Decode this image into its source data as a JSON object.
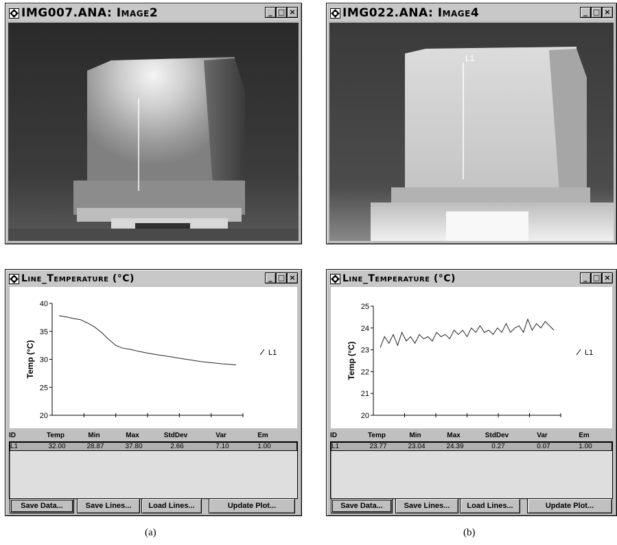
{
  "panels": {
    "a": {
      "image_window_title": "IMG007.ANA: Image2",
      "image_line_label": "",
      "plot_window_title": "Line_Temperature (°C)",
      "caption": "(a)",
      "chart_data": {
        "type": "line",
        "ylabel": "Temp (°C)",
        "ylim": [
          20,
          40
        ],
        "yticks": [
          "20",
          "25",
          "30",
          "35",
          "40"
        ],
        "legend": "L1",
        "series": [
          {
            "name": "L1",
            "x": [
              0,
              0.04,
              0.08,
              0.12,
              0.16,
              0.2,
              0.24,
              0.28,
              0.32,
              0.36,
              0.4,
              0.44,
              0.5,
              0.56,
              0.62,
              0.68,
              0.74,
              0.8,
              0.86,
              0.92,
              0.96,
              1.0
            ],
            "values": [
              37.8,
              37.6,
              37.3,
              37.1,
              36.5,
              35.8,
              34.8,
              33.6,
              32.5,
              32.0,
              31.8,
              31.5,
              31.1,
              30.8,
              30.5,
              30.2,
              29.9,
              29.6,
              29.4,
              29.2,
              29.1,
              29.0
            ]
          }
        ]
      },
      "stats": {
        "headers": [
          "ID",
          "Temp",
          "Min",
          "Max",
          "StdDev",
          "Var",
          "Em"
        ],
        "row": [
          "L1",
          "32.00",
          "28.87",
          "37.80",
          "2.66",
          "7.10",
          "1.00"
        ]
      },
      "buttons": [
        "Save Data...",
        "Save Lines...",
        "Load Lines...",
        "Update Plot..."
      ]
    },
    "b": {
      "image_window_title": "IMG022.ANA: Image4",
      "image_line_label": "L1",
      "plot_window_title": "Line_Temperature (°C)",
      "caption": "(b)",
      "chart_data": {
        "type": "line",
        "ylabel": "Temp (°C)",
        "ylim": [
          20,
          25
        ],
        "yticks": [
          "20",
          "21",
          "22",
          "23",
          "24",
          "25"
        ],
        "legend": "L1",
        "series": [
          {
            "name": "L1",
            "x": [
              0,
              0.025,
              0.05,
              0.075,
              0.1,
              0.125,
              0.15,
              0.175,
              0.2,
              0.225,
              0.25,
              0.275,
              0.3,
              0.325,
              0.35,
              0.375,
              0.4,
              0.425,
              0.45,
              0.475,
              0.5,
              0.525,
              0.55,
              0.575,
              0.6,
              0.625,
              0.65,
              0.675,
              0.7,
              0.725,
              0.75,
              0.775,
              0.8,
              0.825,
              0.85,
              0.875,
              0.9,
              0.925,
              0.95,
              0.975,
              1.0
            ],
            "values": [
              23.1,
              23.6,
              23.3,
              23.7,
              23.2,
              23.8,
              23.4,
              23.6,
              23.3,
              23.7,
              23.5,
              23.6,
              23.4,
              23.8,
              23.6,
              23.7,
              23.5,
              23.9,
              23.7,
              23.9,
              23.6,
              24.0,
              23.8,
              24.1,
              23.8,
              23.9,
              23.7,
              24.0,
              23.8,
              24.2,
              23.8,
              24.0,
              24.1,
              23.8,
              24.4,
              23.9,
              24.2,
              24.0,
              24.3,
              24.1,
              23.9
            ]
          }
        ]
      },
      "stats": {
        "headers": [
          "ID",
          "Temp",
          "Min",
          "Max",
          "StdDev",
          "Var",
          "Em"
        ],
        "row": [
          "L1",
          "23.77",
          "23.04",
          "24.39",
          "0.27",
          "0.07",
          "1.00"
        ]
      },
      "buttons": [
        "Save Data...",
        "Save Lines...",
        "Load Lines...",
        "Update Plot..."
      ]
    }
  },
  "window_buttons": {
    "minimize": "_",
    "maximize": "□",
    "close": "×"
  },
  "icons": [
    "app-icon",
    "minimize-icon",
    "maximize-icon",
    "close-icon"
  ]
}
